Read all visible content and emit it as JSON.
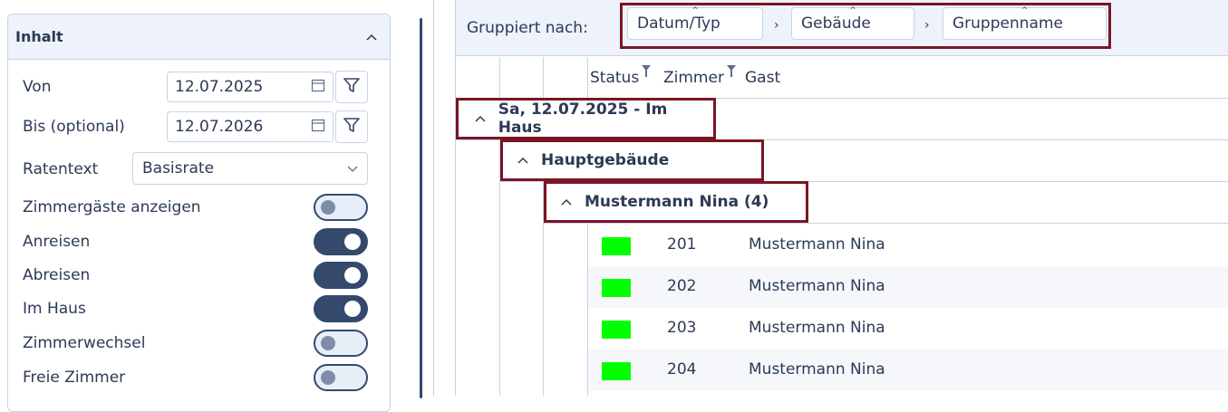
{
  "sidebar": {
    "title": "Inhalt",
    "von_label": "Von",
    "von_value": "12.07.2025",
    "bis_label": "Bis (optional)",
    "bis_value": "12.07.2026",
    "ratentext_label": "Ratentext",
    "ratentext_value": "Basisrate",
    "toggles": [
      {
        "label": "Zimmergäste anzeigen",
        "on": false
      },
      {
        "label": "Anreisen",
        "on": true
      },
      {
        "label": "Abreisen",
        "on": true
      },
      {
        "label": "Im Haus",
        "on": true
      },
      {
        "label": "Zimmerwechsel",
        "on": false
      },
      {
        "label": "Freie Zimmer",
        "on": false
      }
    ]
  },
  "grid": {
    "group_by_label": "Gruppiert nach:",
    "group_chips": [
      "Datum/Typ",
      "Gebäude",
      "Gruppenname"
    ],
    "columns": [
      "Status",
      "Zimmer",
      "Gast"
    ],
    "group_level1": "Sa, 12.07.2025 - Im Haus",
    "group_level2": "Hauptgebäude",
    "group_level3": "Mustermann Nina (4)",
    "rows": [
      {
        "status_color": "#00ff00",
        "room": "201",
        "guest": "Mustermann Nina"
      },
      {
        "status_color": "#00ff00",
        "room": "202",
        "guest": "Mustermann Nina"
      },
      {
        "status_color": "#00ff00",
        "room": "203",
        "guest": "Mustermann Nina"
      },
      {
        "status_color": "#00ff00",
        "room": "204",
        "guest": "Mustermann Nina"
      }
    ]
  },
  "colors": {
    "highlight": "#7b1523",
    "primary": "#34496c",
    "status_ok": "#00ff00"
  }
}
